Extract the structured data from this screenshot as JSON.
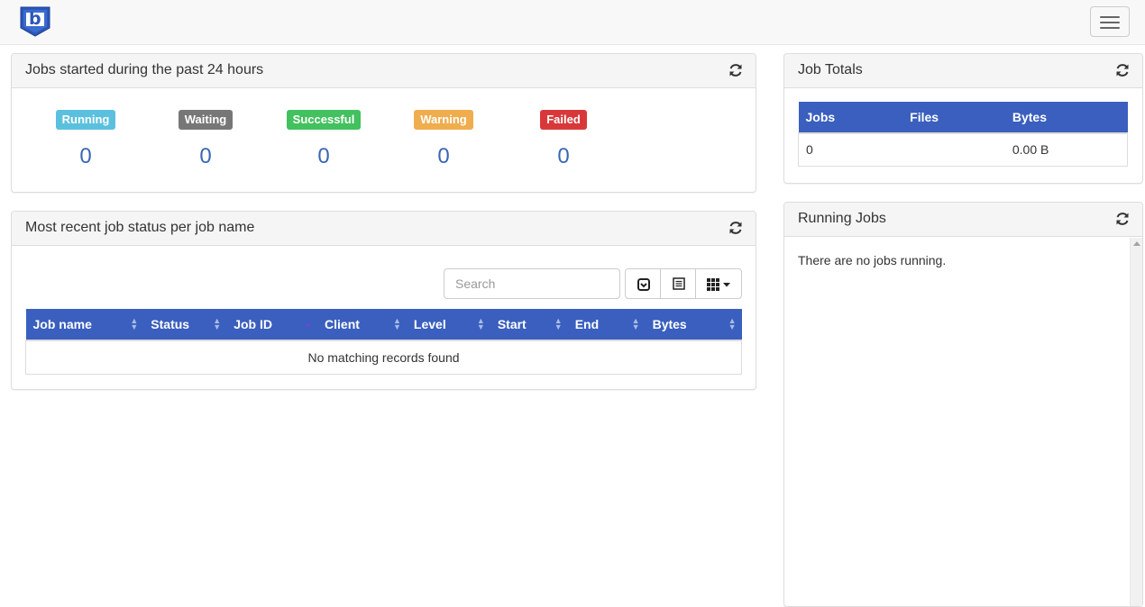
{
  "colors": {
    "running": "#5bc0de",
    "waiting": "#777777",
    "successful": "#42c15e",
    "warning": "#f0ad4e",
    "failed": "#d9383a",
    "table_header": "#3a5fbe",
    "value_text": "#3a66b5"
  },
  "navbar": {
    "logo_letter": "b",
    "logo_icon": "shield-logo",
    "menu_icon": "hamburger-icon"
  },
  "jobs_24h": {
    "title": "Jobs started during the past 24 hours",
    "stats": [
      {
        "label": "Running",
        "value": "0"
      },
      {
        "label": "Waiting",
        "value": "0"
      },
      {
        "label": "Successful",
        "value": "0"
      },
      {
        "label": "Warning",
        "value": "0"
      },
      {
        "label": "Failed",
        "value": "0"
      }
    ]
  },
  "recent_status": {
    "title": "Most recent job status per job name",
    "search_placeholder": "Search",
    "toolbar_icons": [
      "toggle-icon",
      "list-view-icon",
      "columns-grid-icon"
    ],
    "columns": [
      "Job name",
      "Status",
      "Job ID",
      "Client",
      "Level",
      "Start",
      "End",
      "Bytes"
    ],
    "empty_message": "No matching records found"
  },
  "job_totals": {
    "title": "Job Totals",
    "columns": [
      "Jobs",
      "Files",
      "Bytes"
    ],
    "row": [
      "0",
      "",
      "0.00 B"
    ]
  },
  "running_jobs": {
    "title": "Running Jobs",
    "message": "There are no jobs running."
  }
}
